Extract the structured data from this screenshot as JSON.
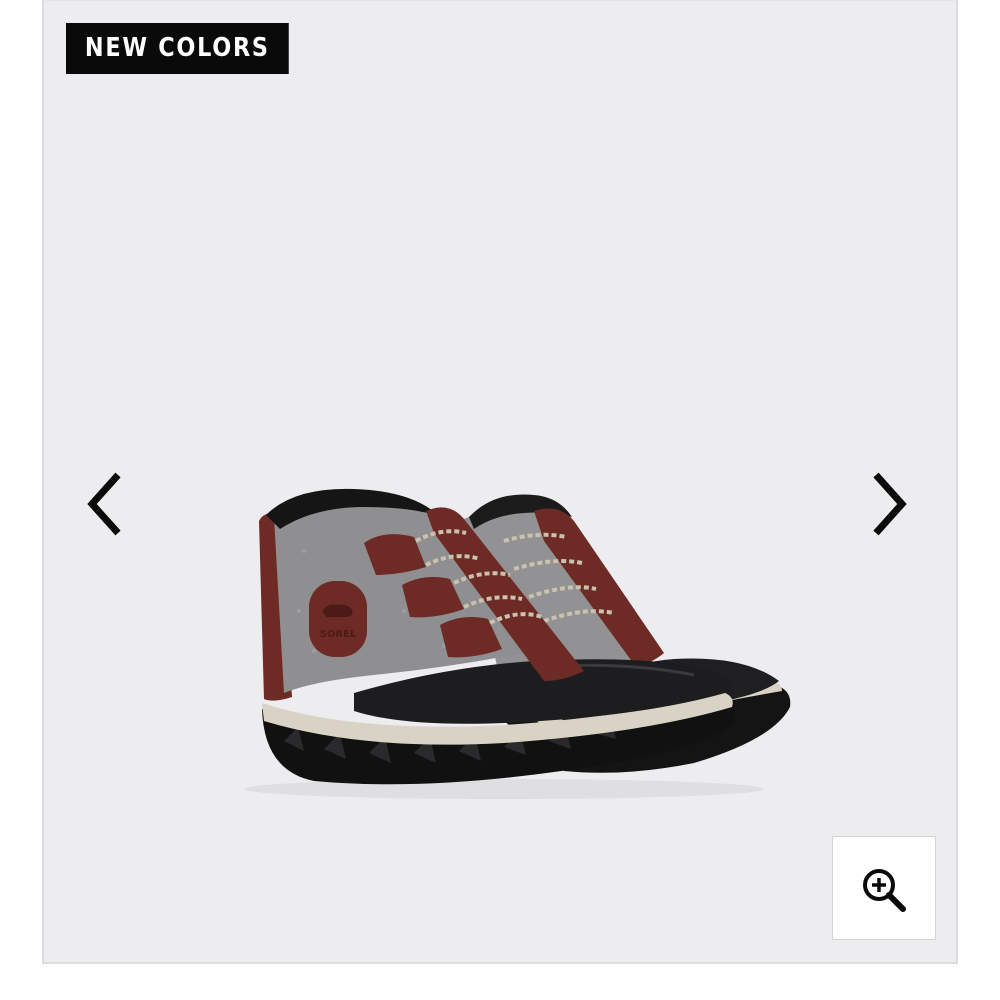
{
  "gallery": {
    "badge_label": "NEW COLORS",
    "product_brand_mark": "SOREL",
    "icons": {
      "prev": "chevron-left-icon",
      "next": "chevron-right-icon",
      "zoom": "zoom-in-icon"
    },
    "colors": {
      "background": "#ededef",
      "badge_bg": "#0a0a0a",
      "badge_text": "#ffffff",
      "felt_gray": "#8d8d8f",
      "leather_burgundy": "#6e2a24",
      "rubber_black": "#1a1a1a",
      "midsole_cream": "#d9d3c6"
    }
  }
}
